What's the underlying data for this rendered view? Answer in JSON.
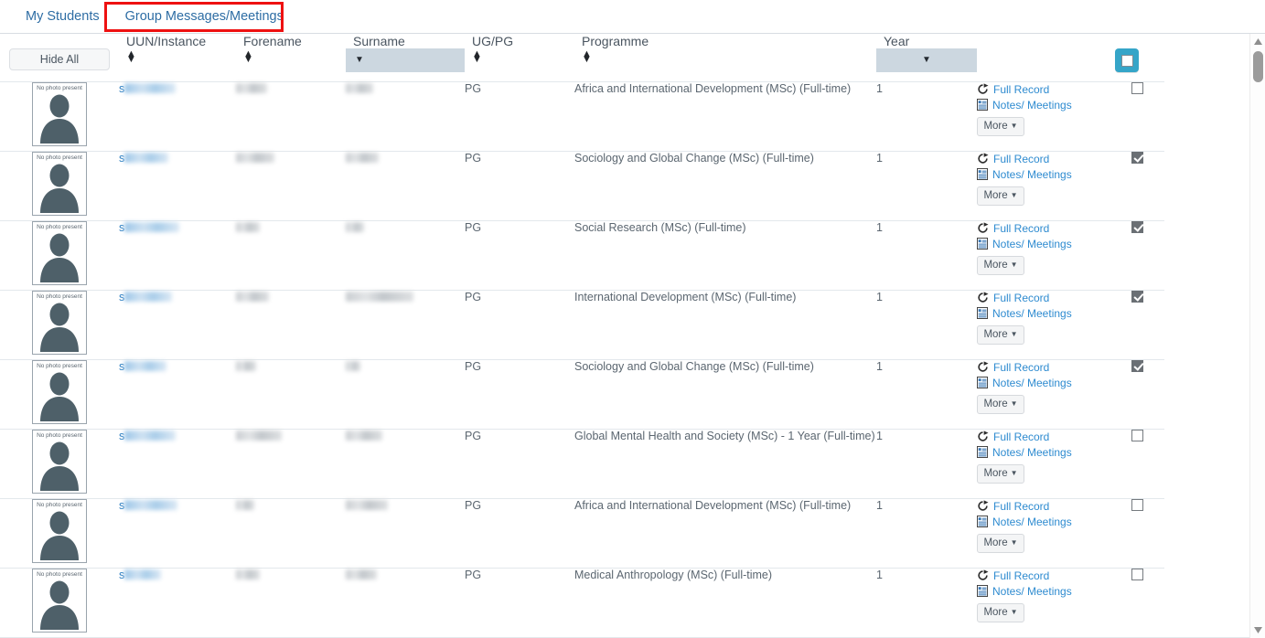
{
  "tabs": [
    {
      "label": "My Students",
      "active": false
    },
    {
      "label": "Group Messages/Meetings",
      "active": true
    }
  ],
  "toolbar": {
    "hide_all_label": "Hide All"
  },
  "columns": [
    {
      "key": "photo",
      "label": ""
    },
    {
      "key": "uun",
      "label": "UUN/Instance",
      "control": "sort"
    },
    {
      "key": "forename",
      "label": "Forename",
      "control": "sort"
    },
    {
      "key": "surname",
      "label": "Surname",
      "control": "filter"
    },
    {
      "key": "ugpg",
      "label": "UG/PG",
      "control": "sort"
    },
    {
      "key": "programme",
      "label": "Programme",
      "control": "sort"
    },
    {
      "key": "year",
      "label": "Year",
      "control": "filter"
    },
    {
      "key": "actions",
      "label": ""
    },
    {
      "key": "select",
      "label": ""
    }
  ],
  "select_all": {
    "checked": false
  },
  "row_actions": {
    "full_record_label": "Full Record",
    "notes_meetings_label": "Notes/ Meetings",
    "more_label": "More"
  },
  "avatar": {
    "no_photo_label": "No photo present"
  },
  "rows": [
    {
      "uun": "s",
      "forename": "",
      "surname": "",
      "ugpg": "PG",
      "programme": "Africa and International Development (MSc) (Full-time)",
      "year": "1",
      "selected": false
    },
    {
      "uun": "s",
      "forename": "",
      "surname": "",
      "ugpg": "PG",
      "programme": "Sociology and Global Change (MSc) (Full-time)",
      "year": "1",
      "selected": true
    },
    {
      "uun": "s",
      "forename": "",
      "surname": "",
      "ugpg": "PG",
      "programme": "Social Research (MSc) (Full-time)",
      "year": "1",
      "selected": true
    },
    {
      "uun": "s",
      "forename": "",
      "surname": "",
      "ugpg": "PG",
      "programme": "International Development (MSc) (Full-time)",
      "year": "1",
      "selected": true
    },
    {
      "uun": "s",
      "forename": "",
      "surname": "",
      "ugpg": "PG",
      "programme": "Sociology and Global Change (MSc) (Full-time)",
      "year": "1",
      "selected": true
    },
    {
      "uun": "s",
      "forename": "",
      "surname": "",
      "ugpg": "PG",
      "programme": "Global Mental Health and Society (MSc) - 1 Year (Full-time)",
      "year": "1",
      "selected": false
    },
    {
      "uun": "s",
      "forename": "",
      "surname": "",
      "ugpg": "PG",
      "programme": "Africa and International Development (MSc) (Full-time)",
      "year": "1",
      "selected": false
    },
    {
      "uun": "s",
      "forename": "",
      "surname": "",
      "ugpg": "PG",
      "programme": "Medical Anthropology (MSc) (Full-time)",
      "year": "1",
      "selected": false
    }
  ],
  "colors": {
    "link": "#2e8bd0",
    "tab_link": "#2e6da4",
    "filter_bg": "#ccd7e0",
    "select_all_bg": "#35a5c8",
    "annotation": "#ee1111",
    "text": "#5b6670"
  }
}
